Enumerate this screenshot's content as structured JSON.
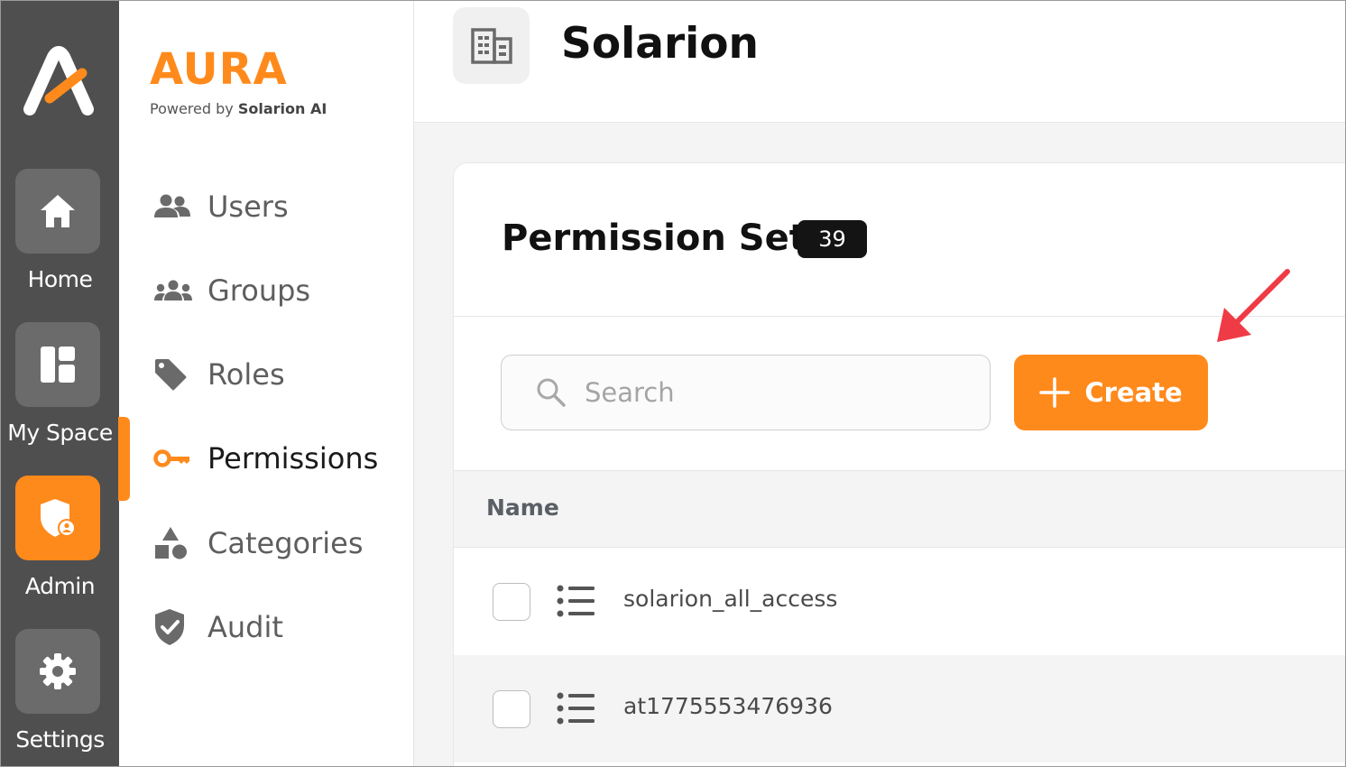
{
  "rail": {
    "items": [
      {
        "label": "Home",
        "icon": "home-icon"
      },
      {
        "label": "My Space",
        "icon": "dashboard-icon"
      },
      {
        "label": "Admin",
        "icon": "admin-shield-icon",
        "active": true
      },
      {
        "label": "Settings",
        "icon": "gear-icon"
      }
    ]
  },
  "brand": {
    "name": "AURA",
    "powered_prefix": "Powered by",
    "powered_name": "Solarion AI"
  },
  "nav": {
    "items": [
      {
        "label": "Users",
        "icon": "users-icon"
      },
      {
        "label": "Groups",
        "icon": "groups-icon"
      },
      {
        "label": "Roles",
        "icon": "tag-icon"
      },
      {
        "label": "Permissions",
        "icon": "key-icon",
        "active": true
      },
      {
        "label": "Categories",
        "icon": "shapes-icon"
      },
      {
        "label": "Audit",
        "icon": "shield-check-icon"
      }
    ]
  },
  "header": {
    "org_name": "Solarion",
    "org_icon": "building-icon"
  },
  "page": {
    "title": "Permission Sets",
    "count": "39",
    "search_placeholder": "Search",
    "create_label": "Create"
  },
  "table": {
    "columns": [
      "Name"
    ],
    "rows": [
      {
        "name": "solarion_all_access"
      },
      {
        "name": "at1775553476936"
      }
    ]
  },
  "colors": {
    "accent": "#ff8a1c",
    "rail_bg": "#4f4f4f",
    "annotation_arrow": "#ef3b45"
  }
}
